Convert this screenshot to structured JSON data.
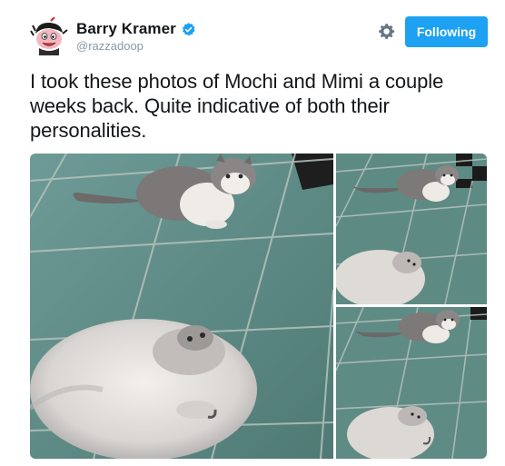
{
  "tweet": {
    "author": {
      "display_name": "Barry Kramer",
      "handle": "@razzadoop",
      "verified": true,
      "avatar_icon": "cartoon-face-avatar"
    },
    "actions": {
      "settings_icon": "gear-icon",
      "follow_label": "Following"
    },
    "text": "I took these photos of Mochi and Mimi a couple weeks back. Quite indicative of both their personalities.",
    "media": {
      "photos": [
        {
          "subject": "photo-1"
        },
        {
          "subject": "photo-2"
        },
        {
          "subject": "photo-3"
        }
      ]
    }
  },
  "colors": {
    "accent": "#1da1f2",
    "text": "#14171a",
    "muted": "#8899a6",
    "floor": "#5e8a84"
  }
}
